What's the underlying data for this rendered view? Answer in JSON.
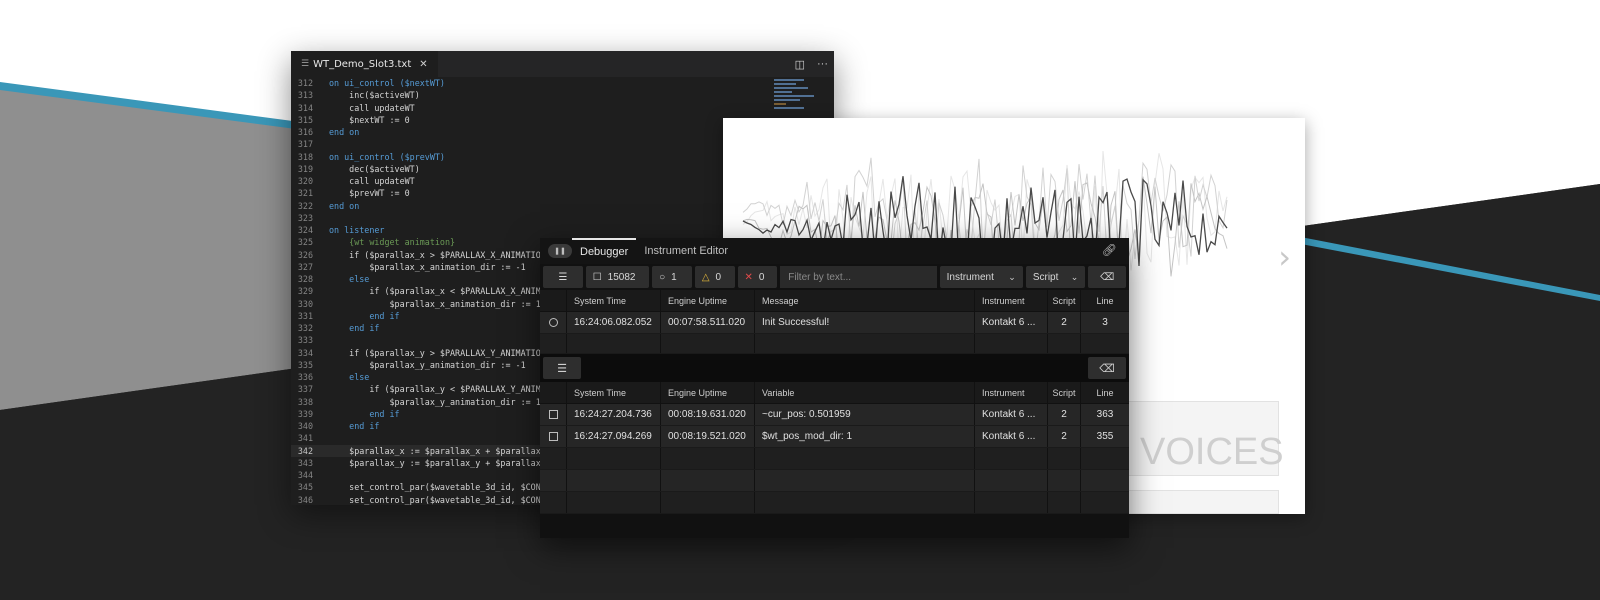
{
  "editor": {
    "tab_label": "WT_Demo_Slot3.txt",
    "icons": [
      "file-icon",
      "close-icon",
      "split-editor-icon",
      "more-icon"
    ],
    "lines": [
      {
        "no": "312",
        "text": "on ui_control ($nextWT)"
      },
      {
        "no": "313",
        "text": "    inc($activeWT)"
      },
      {
        "no": "314",
        "text": "    call updateWT"
      },
      {
        "no": "315",
        "text": "    $nextWT := 0"
      },
      {
        "no": "316",
        "text": "end on"
      },
      {
        "no": "317",
        "text": ""
      },
      {
        "no": "318",
        "text": "on ui_control ($prevWT)"
      },
      {
        "no": "319",
        "text": "    dec($activeWT)"
      },
      {
        "no": "320",
        "text": "    call updateWT"
      },
      {
        "no": "321",
        "text": "    $prevWT := 0"
      },
      {
        "no": "322",
        "text": "end on"
      },
      {
        "no": "323",
        "text": ""
      },
      {
        "no": "324",
        "text": "on listener"
      },
      {
        "no": "325",
        "text": "    {wt widget animation}"
      },
      {
        "no": "326",
        "text": "    if ($parallax_x > $PARALLAX_X_ANIMATIO"
      },
      {
        "no": "327",
        "text": "        $parallax_x_animation_dir := -1"
      },
      {
        "no": "328",
        "text": "    else"
      },
      {
        "no": "329",
        "text": "        if ($parallax_x < $PARALLAX_X_ANIM"
      },
      {
        "no": "330",
        "text": "            $parallax_x_animation_dir := 1"
      },
      {
        "no": "331",
        "text": "        end if"
      },
      {
        "no": "332",
        "text": "    end if"
      },
      {
        "no": "333",
        "text": ""
      },
      {
        "no": "334",
        "text": "    if ($parallax_y > $PARALLAX_Y_ANIMATIO"
      },
      {
        "no": "335",
        "text": "        $parallax_y_animation_dir := -1"
      },
      {
        "no": "336",
        "text": "    else"
      },
      {
        "no": "337",
        "text": "        if ($parallax_y < $PARALLAX_Y_ANIM"
      },
      {
        "no": "338",
        "text": "            $parallax_y_animation_dir := 1"
      },
      {
        "no": "339",
        "text": "        end if"
      },
      {
        "no": "340",
        "text": "    end if"
      },
      {
        "no": "341",
        "text": ""
      },
      {
        "no": "342",
        "text": "    $parallax_x := $parallax_x + $parallax"
      },
      {
        "no": "343",
        "text": "    $parallax_y := $parallax_y + $parallax"
      },
      {
        "no": "344",
        "text": ""
      },
      {
        "no": "345",
        "text": "    set_control_par($wavetable_3d_id, $CON"
      },
      {
        "no": "346",
        "text": "    set_control_par($wavetable_3d_id, $CON"
      }
    ],
    "current_line": "342"
  },
  "wave_panel": {
    "voices_text": "VOICES",
    "next_icon": "chevron-right-icon"
  },
  "debugger": {
    "pause_icon": "pause-icon",
    "tabs": [
      "Debugger",
      "Instrument Editor"
    ],
    "link_icon": "link-icon",
    "toolbar": {
      "filter_icon": "sliders-icon",
      "total_count": "15082",
      "info_count": "1",
      "warning_count": "0",
      "error_count": "0",
      "filter_placeholder": "Filter by text...",
      "instrument_dropdown": "Instrument",
      "script_dropdown": "Script",
      "clear_icon": "eraser-icon"
    },
    "log_table": {
      "headers": [
        "System Time",
        "Engine Uptime",
        "Message",
        "Instrument",
        "Script",
        "Line"
      ],
      "rows": [
        {
          "system_time": "16:24:06.082.052",
          "uptime": "00:07:58.511.020",
          "message": "Init Successful!",
          "instrument": "Kontakt 6 ...",
          "script": "2",
          "line": "3"
        }
      ]
    },
    "var_table": {
      "headers": [
        "System Time",
        "Engine Uptime",
        "Variable",
        "Instrument",
        "Script",
        "Line"
      ],
      "rows": [
        {
          "system_time": "16:24:27.204.736",
          "uptime": "00:08:19.631.020",
          "variable": "~cur_pos: 0.501959",
          "instrument": "Kontakt 6 ...",
          "script": "2",
          "line": "363"
        },
        {
          "system_time": "16:24:27.094.269",
          "uptime": "00:08:19.521.020",
          "variable": "$wt_pos_mod_dir: 1",
          "instrument": "Kontakt 6 ...",
          "script": "2",
          "line": "355"
        }
      ]
    }
  },
  "colors": {
    "accent_stripe": "#3a97b8",
    "dark_bg": "#242424",
    "gray_bg": "#8c8c8c"
  }
}
